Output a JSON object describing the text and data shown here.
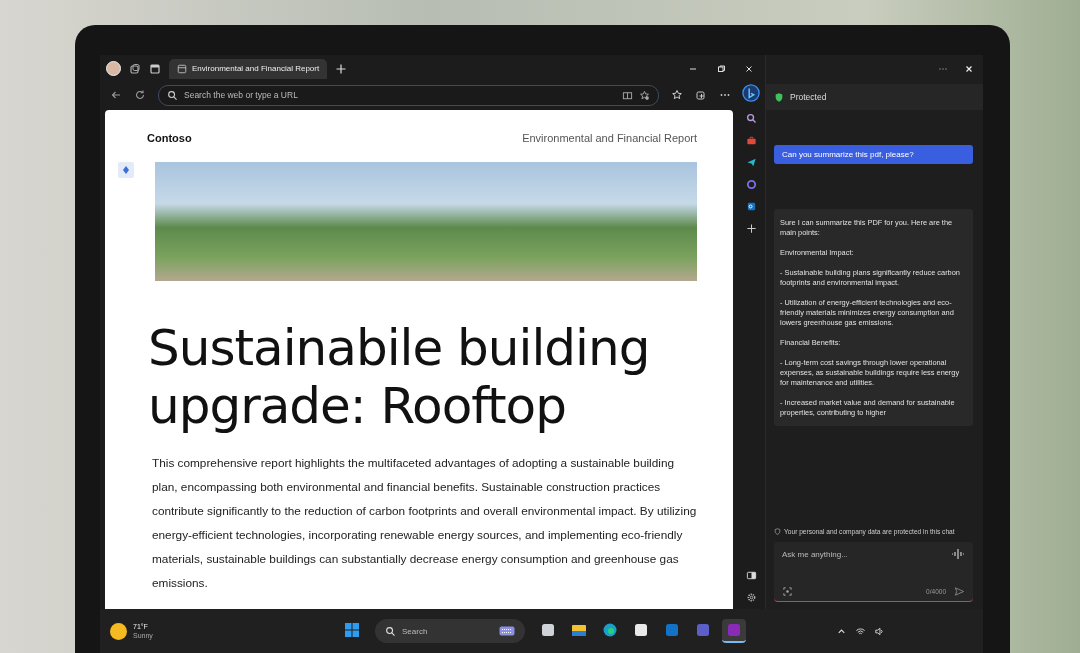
{
  "browser": {
    "tabs": [
      {
        "label": "Environmental and Financial Report",
        "selected": true
      }
    ],
    "address_bar": {
      "placeholder": "Search the web or type a URL"
    }
  },
  "pdf": {
    "brand": "Contoso",
    "header_title": "Environmental and Financial Report",
    "heading": "Sustainabile building upgrade: Rooftop",
    "body": "This comprehensive report highlights the multifaceted advantages of adopting a sustainable building plan, encompassing both environmental and financial benefits. Sustainable construction practices contribute significantly to the reduction of carbon footprints and overall environmental impact. By utilizing energy-efficient technologies, incorporating renewable energy sources, and implementing eco-friendly materials, sustainable buildings can substantially decrease energy consumption and greenhouse gas emissions."
  },
  "copilot": {
    "status": "Protected",
    "prompt": "Can you summarize this pdf, please?",
    "reply": {
      "paragraphs": [
        "Sure I can summarize this PDF for you. Here are the main points:",
        "Environmental Impact:",
        "- Sustainable building plans significantly reduce carbon footprints and environmental impact.",
        "- Utilization of energy-efficient technologies and eco-friendly materials minimizes energy consumption and lowers greenhouse gas emissions.",
        "Financial Benefits:",
        "- Long-term cost savings through lower operational expenses, as sustainable buildings require less energy for maintenance and utilities.",
        "- Increased market value and demand for sustainable properties, contributing to higher"
      ]
    },
    "disclaimer": "Your personal and company data are protected in this chat",
    "input": {
      "placeholder": "Ask me anything...",
      "counter": "0/4000"
    }
  },
  "taskbar": {
    "weather": {
      "temperature": "71°F",
      "condition": "Sunny"
    },
    "search": {
      "placeholder": "Search"
    },
    "apps": [
      {
        "kind": "start",
        "active": false
      },
      {
        "kind": "task-view",
        "active": false
      },
      {
        "kind": "folder",
        "active": false
      },
      {
        "kind": "browser",
        "active": false
      },
      {
        "kind": "store",
        "active": false
      },
      {
        "kind": "mail",
        "active": false
      },
      {
        "kind": "chat",
        "active": false
      },
      {
        "kind": "notes",
        "active": true
      }
    ]
  }
}
